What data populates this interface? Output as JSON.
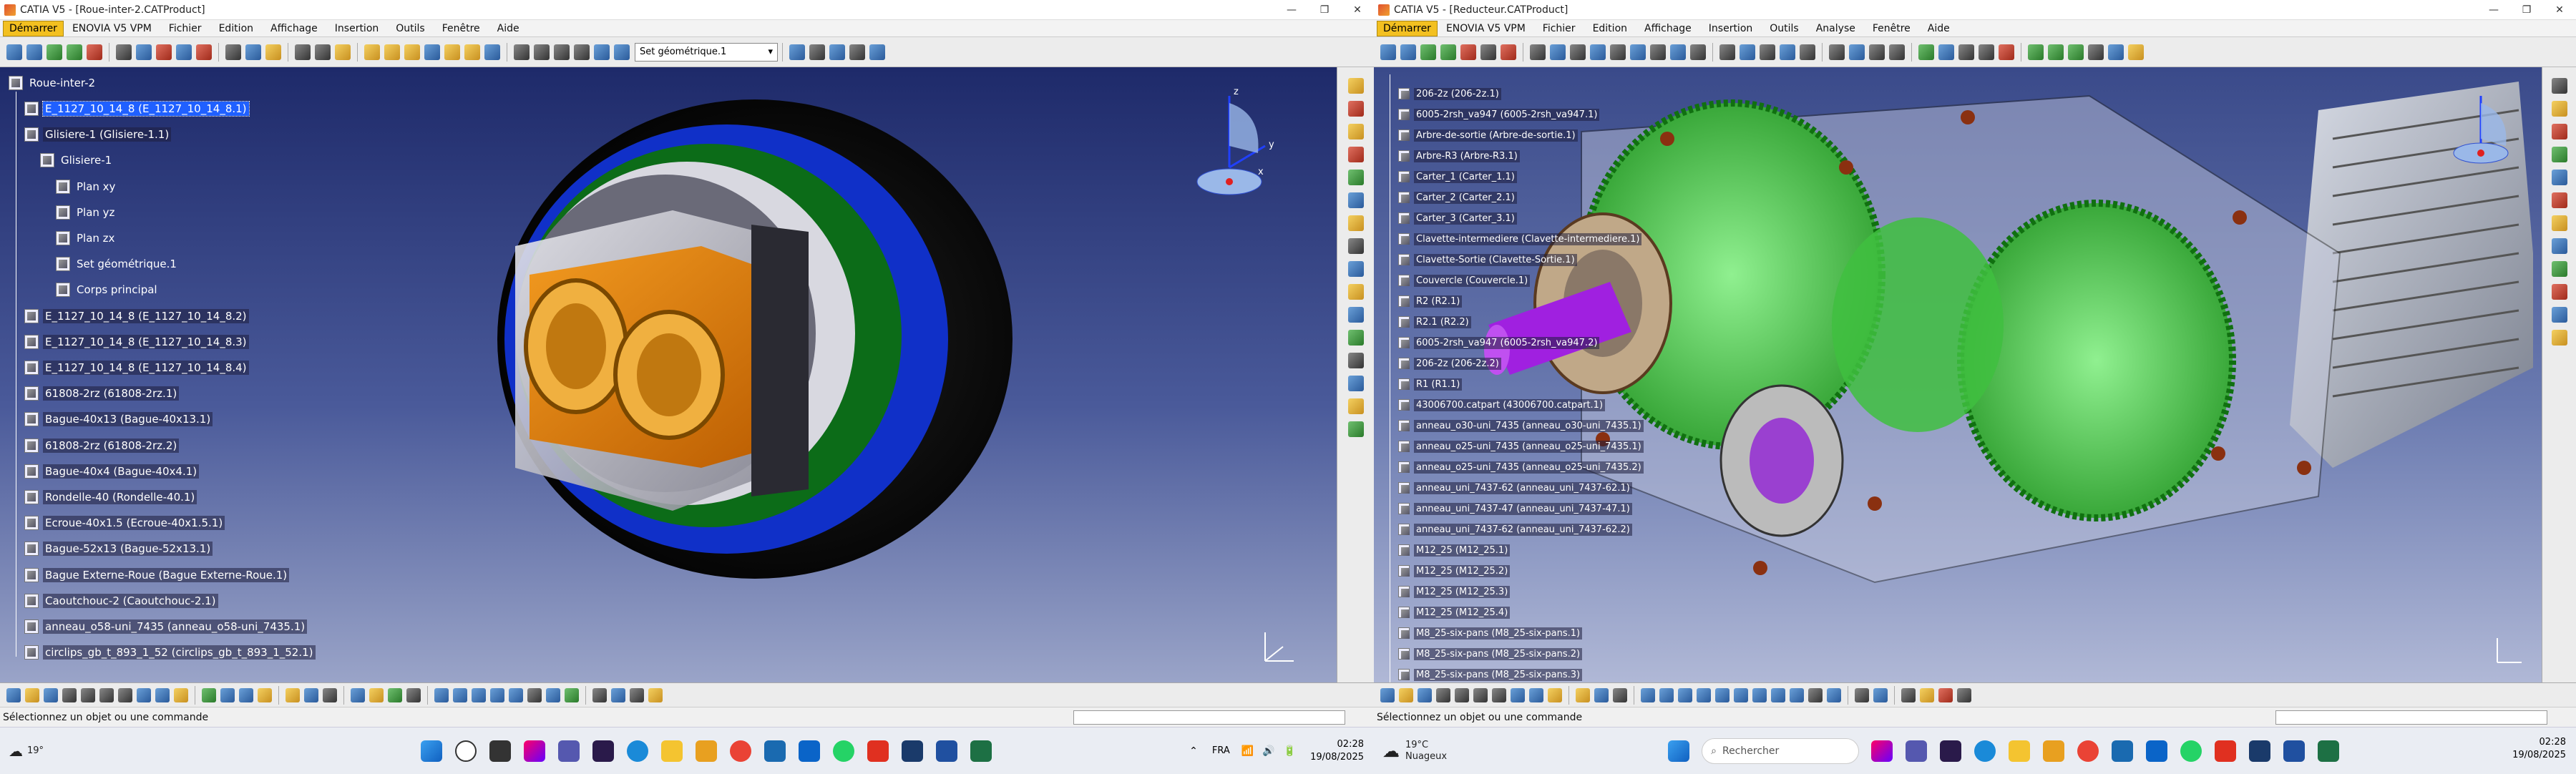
{
  "left_window": {
    "title": "CATIA V5 - [Roue-inter-2.CATProduct]",
    "menu": [
      "Démarrer",
      "ENOVIA V5 VPM",
      "Fichier",
      "Edition",
      "Affichage",
      "Insertion",
      "Outils",
      "Fenêtre",
      "Aide"
    ],
    "set_selector": "Set géométrique.1",
    "tree": {
      "root": "Roue-inter-2",
      "items": [
        "E_1127_10_14_8 (E_1127_10_14_8.1)",
        "Glisiere-1 (Glisiere-1.1)",
        "Glisiere-1",
        "Plan xy",
        "Plan yz",
        "Plan zx",
        "Set géométrique.1",
        "Corps principal",
        "E_1127_10_14_8 (E_1127_10_14_8.2)",
        "E_1127_10_14_8 (E_1127_10_14_8.3)",
        "E_1127_10_14_8 (E_1127_10_14_8.4)",
        "61808-2rz (61808-2rz.1)",
        "Bague-40x13 (Bague-40x13.1)",
        "61808-2rz (61808-2rz.2)",
        "Bague-40x4 (Bague-40x4.1)",
        "Rondelle-40 (Rondelle-40.1)",
        "Ecroue-40x1.5 (Ecroue-40x1.5.1)",
        "Bague-52x13 (Bague-52x13.1)",
        "Bague Externe-Roue (Bague Externe-Roue.1)",
        "Caoutchouc-2 (Caoutchouc-2.1)",
        "anneau_o58-uni_7435 (anneau_o58-uni_7435.1)",
        "circlips_gb_t_893_1_52 (circlips_gb_t_893_1_52.1)"
      ]
    },
    "status": "Sélectionnez un objet ou une commande"
  },
  "right_window": {
    "title": "CATIA V5 - [Reducteur.CATProduct]",
    "menu": [
      "Démarrer",
      "ENOVIA V5 VPM",
      "Fichier",
      "Edition",
      "Affichage",
      "Insertion",
      "Outils",
      "Analyse",
      "Fenêtre",
      "Aide"
    ],
    "tree": {
      "items": [
        "206-2z (206-2z.1)",
        "6005-2rsh_va947 (6005-2rsh_va947.1)",
        "Arbre-de-sortie (Arbre-de-sortie.1)",
        "Arbre-R3 (Arbre-R3.1)",
        "Carter_1 (Carter_1.1)",
        "Carter_2 (Carter_2.1)",
        "Carter_3 (Carter_3.1)",
        "Clavette-intermediere (Clavette-intermediere.1)",
        "Clavette-Sortie (Clavette-Sortie.1)",
        "Couvercle (Couvercle.1)",
        "R2 (R2.1)",
        "R2.1 (R2.2)",
        "6005-2rsh_va947 (6005-2rsh_va947.2)",
        "206-2z (206-2z.2)",
        "R1 (R1.1)",
        "43006700.catpart (43006700.catpart.1)",
        "anneau_o30-uni_7435 (anneau_o30-uni_7435.1)",
        "anneau_o25-uni_7435 (anneau_o25-uni_7435.1)",
        "anneau_o25-uni_7435 (anneau_o25-uni_7435.2)",
        "anneau_uni_7437-62 (anneau_uni_7437-62.1)",
        "anneau_uni_7437-47 (anneau_uni_7437-47.1)",
        "anneau_uni_7437-62 (anneau_uni_7437-62.2)",
        "M12_25 (M12_25.1)",
        "M12_25 (M12_25.2)",
        "M12_25 (M12_25.3)",
        "M12_25 (M12_25.4)",
        "M8_25-six-pans (M8_25-six-pans.1)",
        "M8_25-six-pans (M8_25-six-pans.2)",
        "M8_25-six-pans (M8_25-six-pans.3)"
      ]
    },
    "status": "Sélectionnez un objet ou une commande"
  },
  "taskbar_left": {
    "weather_temp": "19°",
    "lang": "FRA",
    "time": "02:28",
    "date": "19/08/2025"
  },
  "taskbar_right": {
    "weather_temp": "19°C",
    "weather_desc": "Nuageux",
    "search_placeholder": "Rechercher",
    "time": "02:28",
    "date": "19/08/2025"
  },
  "compass": {
    "x": "x",
    "y": "y",
    "z": "z"
  },
  "colors": {
    "selection": "#2060ff",
    "start_button": "#f3c020"
  }
}
